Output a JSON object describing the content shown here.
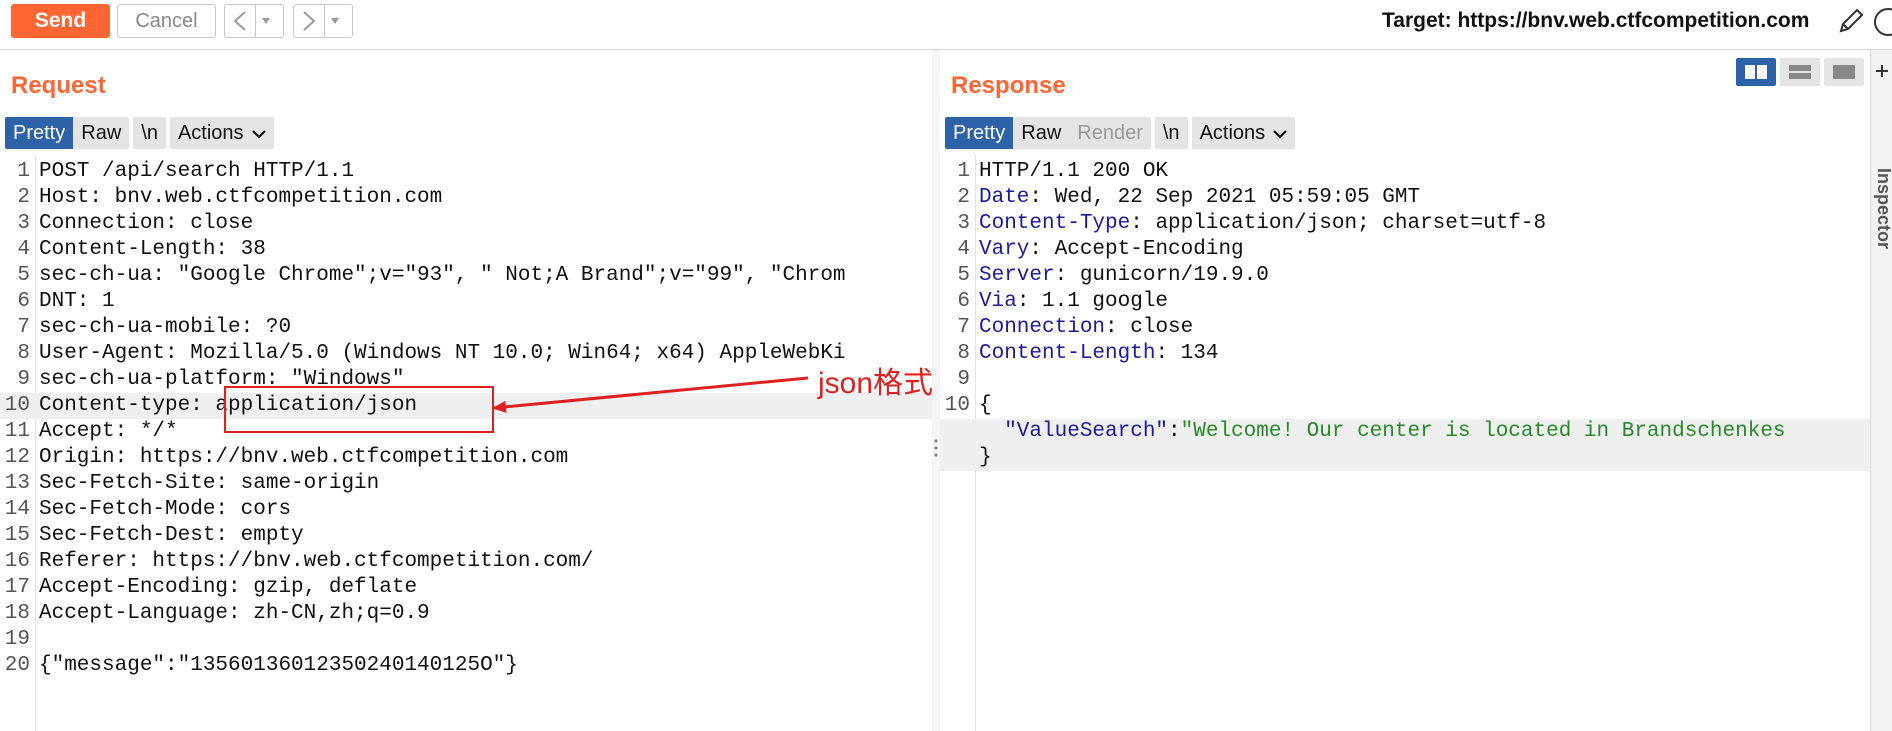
{
  "toolbar": {
    "send_label": "Send",
    "cancel_label": "Cancel",
    "back_glyph": "<",
    "forward_glyph": ">",
    "dropdown_glyph": "▼",
    "target_label": "Target: https://bnv.web.ctfcompetition.com"
  },
  "request": {
    "title": "Request",
    "tabs": {
      "pretty": "Pretty",
      "raw": "Raw",
      "newline": "\\n",
      "actions": "Actions"
    },
    "lines": [
      {
        "n": "1",
        "text": "POST /api/search HTTP/1.1"
      },
      {
        "n": "2",
        "text": "Host: bnv.web.ctfcompetition.com"
      },
      {
        "n": "3",
        "text": "Connection: close"
      },
      {
        "n": "4",
        "text": "Content-Length: 38"
      },
      {
        "n": "5",
        "text": "sec-ch-ua: \"Google Chrome\";v=\"93\", \" Not;A Brand\";v=\"99\", \"Chrom"
      },
      {
        "n": "6",
        "text": "DNT: 1"
      },
      {
        "n": "7",
        "text": "sec-ch-ua-mobile: ?0"
      },
      {
        "n": "8",
        "text": "User-Agent: Mozilla/5.0 (Windows NT 10.0; Win64; x64) AppleWebKi"
      },
      {
        "n": "9",
        "text": "sec-ch-ua-platform: \"Windows\""
      },
      {
        "n": "10",
        "text": "Content-type: application/json"
      },
      {
        "n": "11",
        "text": "Accept: */*"
      },
      {
        "n": "12",
        "text": "Origin: https://bnv.web.ctfcompetition.com"
      },
      {
        "n": "13",
        "text": "Sec-Fetch-Site: same-origin"
      },
      {
        "n": "14",
        "text": "Sec-Fetch-Mode: cors"
      },
      {
        "n": "15",
        "text": "Sec-Fetch-Dest: empty"
      },
      {
        "n": "16",
        "text": "Referer: https://bnv.web.ctfcompetition.com/"
      },
      {
        "n": "17",
        "text": "Accept-Encoding: gzip, deflate"
      },
      {
        "n": "18",
        "text": "Accept-Language: zh-CN,zh;q=0.9"
      },
      {
        "n": "19",
        "text": ""
      },
      {
        "n": "20",
        "text": "{\"message\":\"13560136012350240140125O\"}"
      }
    ]
  },
  "response": {
    "title": "Response",
    "tabs": {
      "pretty": "Pretty",
      "raw": "Raw",
      "render": "Render",
      "newline": "\\n",
      "actions": "Actions"
    },
    "lines": [
      {
        "n": "1",
        "key": "",
        "val": "HTTP/1.1 200 OK"
      },
      {
        "n": "2",
        "key": "Date",
        "val": ": Wed, 22 Sep 2021 05:59:05 GMT"
      },
      {
        "n": "3",
        "key": "Content-Type",
        "val": ": application/json; charset=utf-8"
      },
      {
        "n": "4",
        "key": "Vary",
        "val": ": Accept-Encoding"
      },
      {
        "n": "5",
        "key": "Server",
        "val": ": gunicorn/19.9.0"
      },
      {
        "n": "6",
        "key": "Via",
        "val": ": 1.1 google"
      },
      {
        "n": "7",
        "key": "Connection",
        "val": ": close"
      },
      {
        "n": "8",
        "key": "Content-Length",
        "val": ": 134"
      },
      {
        "n": "9",
        "key": "",
        "val": ""
      },
      {
        "n": "10",
        "key": "",
        "val": "{"
      }
    ],
    "json_key": "  \"ValueSearch\"",
    "json_colon": ":",
    "json_value": "\"Welcome! Our center is located in Brandschenkes",
    "json_close": "}"
  },
  "inspector": {
    "label": "Inspector"
  },
  "annotation": {
    "label": "json格式"
  },
  "colors": {
    "accent": "#ff6633",
    "active_tab": "#2d62a8",
    "annotation": "#e02020"
  }
}
